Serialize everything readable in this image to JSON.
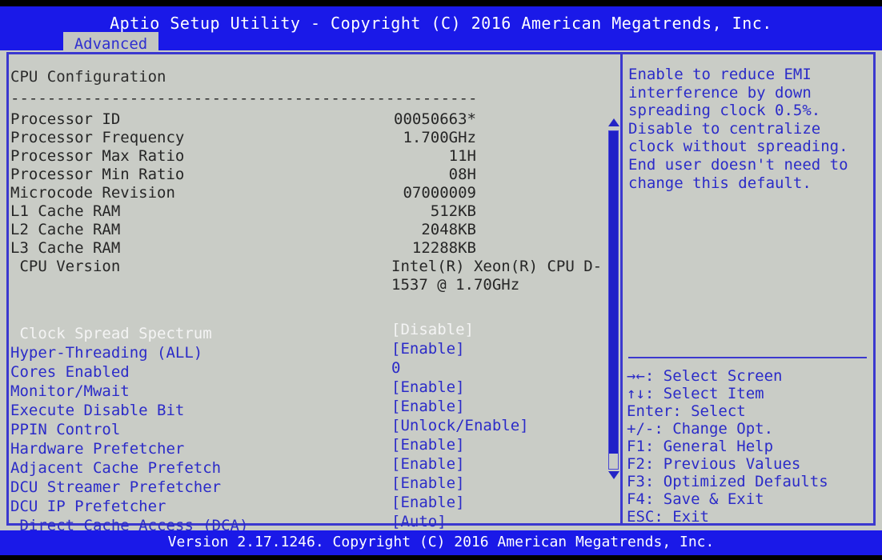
{
  "header": {
    "title": "Aptio Setup Utility - Copyright (C) 2016 American Megatrends, Inc.",
    "active_tab": "Advanced",
    "title_bg": "#1a19e8",
    "tab_bg": "#c3c6c2",
    "tab_fg": "#2f2fd0"
  },
  "main": {
    "section_title": "CPU Configuration",
    "rule": "-------------------------------------------------------------",
    "info_rows": [
      {
        "label": "Processor ID",
        "value": "00050663*"
      },
      {
        "label": "Processor Frequency",
        "value": "1.700GHz"
      },
      {
        "label": "Processor Max Ratio",
        "value": "11H"
      },
      {
        "label": "Processor Min Ratio",
        "value": "08H"
      },
      {
        "label": "Microcode Revision",
        "value": "07000009"
      },
      {
        "label": "L1 Cache RAM",
        "value": "512KB"
      },
      {
        "label": "L2 Cache RAM",
        "value": "2048KB"
      },
      {
        "label": "L3 Cache RAM",
        "value": "12288KB"
      },
      {
        "label": " CPU Version",
        "value": ""
      }
    ],
    "cpu_version_line1": "Intel(R) Xeon(R) CPU D-",
    "cpu_version_line2": "1537 @ 1.70GHz",
    "setting_rows": [
      {
        "label": " Clock Spread Spectrum",
        "value": "[Disable]",
        "selected": true
      },
      {
        "label": "Hyper-Threading (ALL)",
        "value": "[Enable]",
        "selected": false
      },
      {
        "label": "Cores Enabled",
        "value": "0",
        "selected": false
      },
      {
        "label": "Monitor/Mwait",
        "value": "[Enable]",
        "selected": false
      },
      {
        "label": "Execute Disable Bit",
        "value": "[Enable]",
        "selected": false
      },
      {
        "label": "PPIN Control",
        "value": "[Unlock/Enable]",
        "selected": false
      },
      {
        "label": "Hardware Prefetcher",
        "value": "[Enable]",
        "selected": false
      },
      {
        "label": "Adjacent Cache Prefetch",
        "value": "[Enable]",
        "selected": false
      },
      {
        "label": "DCU Streamer Prefetcher",
        "value": "[Enable]",
        "selected": false
      },
      {
        "label": "DCU IP Prefetcher",
        "value": "[Enable]",
        "selected": false
      },
      {
        "label": " Direct Cache Access (DCA)",
        "value": "[Auto]",
        "selected": false
      }
    ]
  },
  "scrollbar": {
    "up_arrow": "scroll-up-arrow",
    "down_arrow": "scroll-down-arrow"
  },
  "help": {
    "text": "Enable to reduce EMI interference by down spreading clock 0.5%. Disable to centralize clock without spreading. End user doesn't need to change this default.",
    "keys": [
      "→←: Select Screen",
      "↑↓: Select Item",
      "Enter: Select",
      "+/-: Change Opt.",
      "F1: General Help",
      "F2: Previous Values",
      "F3: Optimized Defaults",
      "F4: Save & Exit",
      "ESC: Exit"
    ]
  },
  "footer": {
    "text": "Version 2.17.1246. Copyright (C) 2016 American Megatrends, Inc."
  },
  "colors": {
    "screen_bg": "#000000",
    "panel_bg": "#c9ccc6",
    "band_blue": "#1a19e8",
    "frame_blue": "#3b38cf",
    "text_blue": "#2b2bc8",
    "text_dark": "#262626",
    "selected_fg": "#f4f4f4"
  }
}
